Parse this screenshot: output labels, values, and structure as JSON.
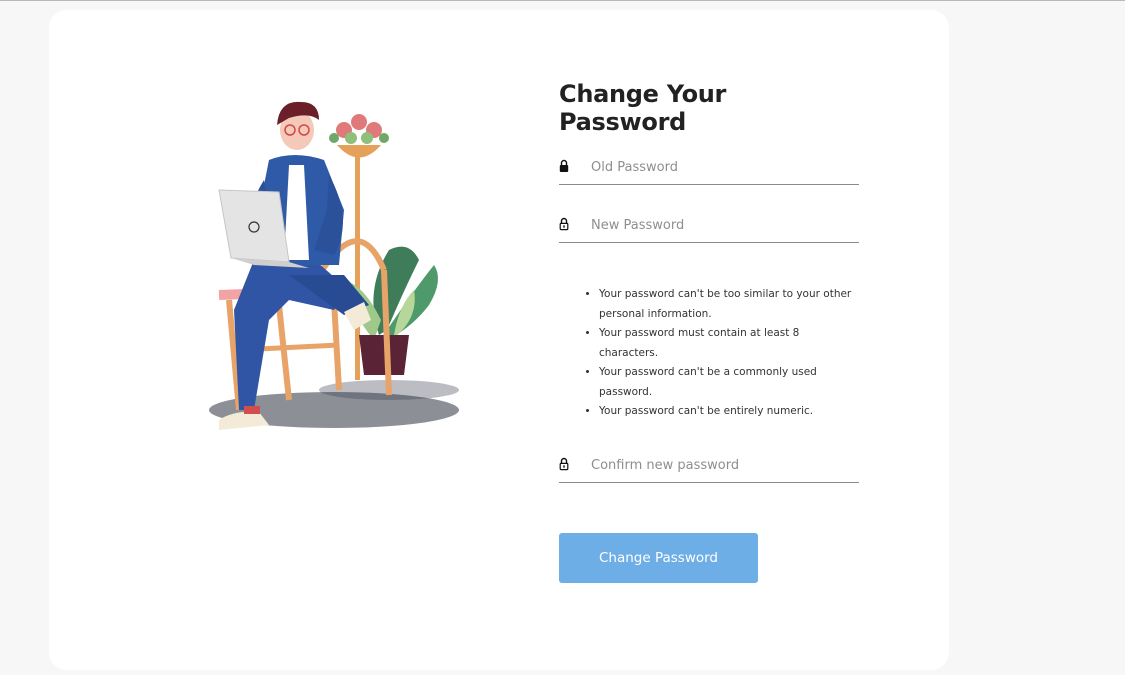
{
  "page": {
    "title": "Change Your Password"
  },
  "form": {
    "old_password": {
      "placeholder": "Old Password",
      "icon": "lock-icon"
    },
    "new_password": {
      "placeholder": "New Password",
      "icon": "lock-icon"
    },
    "confirm_password": {
      "placeholder": "Confirm new password",
      "icon": "lock-icon"
    },
    "rules": [
      "Your password can't be too similar to your other personal information.",
      "Your password must contain at least 8 characters.",
      "Your password can't be a commonly used password.",
      "Your password can't be entirely numeric."
    ],
    "submit_label": "Change Password"
  },
  "colors": {
    "page_background": "#f7f7f7",
    "card_background": "#ffffff",
    "button": "#6eaee6",
    "title": "#222222"
  }
}
